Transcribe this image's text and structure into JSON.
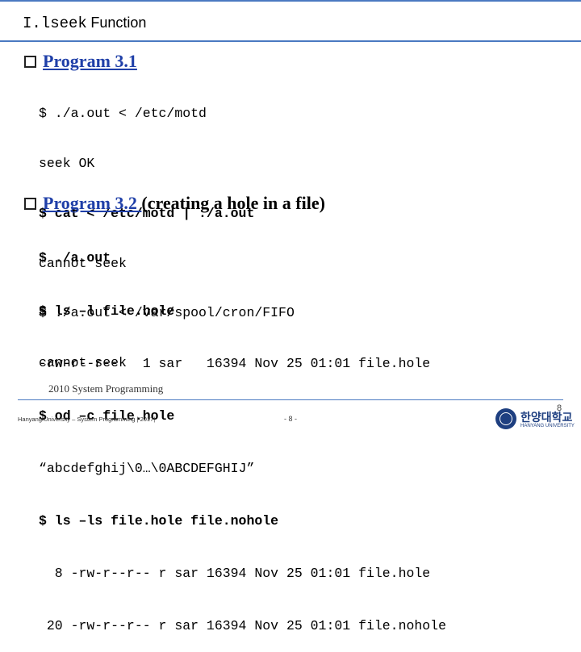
{
  "title": {
    "function_name": "I.lseek",
    "function_word": "Function"
  },
  "section1": {
    "link_text": "Program 3.1",
    "lines": [
      "$ ./a.out < /etc/motd",
      "seek OK",
      "$ cat < /etc/motd | ./a.out",
      "cannot seek",
      "$ ./a.out < /var/spool/cron/FIFO",
      "cannot seek"
    ]
  },
  "section2": {
    "link_text": "Program 3.2 ",
    "rest_text": "(creating a hole in a file)",
    "lines": [
      "$ ./a.out",
      "$ ls –l file.hole",
      "-rw-r--r--   1 sar   16394 Nov 25 01:01 file.hole",
      "$ od –c file.hole",
      "“abcdefghij\\0…\\0ABCDEFGHIJ”",
      "$ ls –ls file.hole file.nohole",
      "  8 -rw-r--r-- r sar 16394 Nov 25 01:01 file.hole",
      " 20 -rw-r--r-- r sar 16394 Nov 25 01:01 file.nohole"
    ]
  },
  "footer": {
    "course": "2010 System Programming",
    "university": "Hanyang University – System Programming | 2017|",
    "page": "- 8 -",
    "corner_page": "8",
    "logo_text": "한양대학교",
    "logo_sub": "HANYANG UNIVERSITY"
  },
  "colors": {
    "accent_rule": "#4a79c1",
    "link": "#1f3fa8",
    "logo": "#1e3f80"
  }
}
